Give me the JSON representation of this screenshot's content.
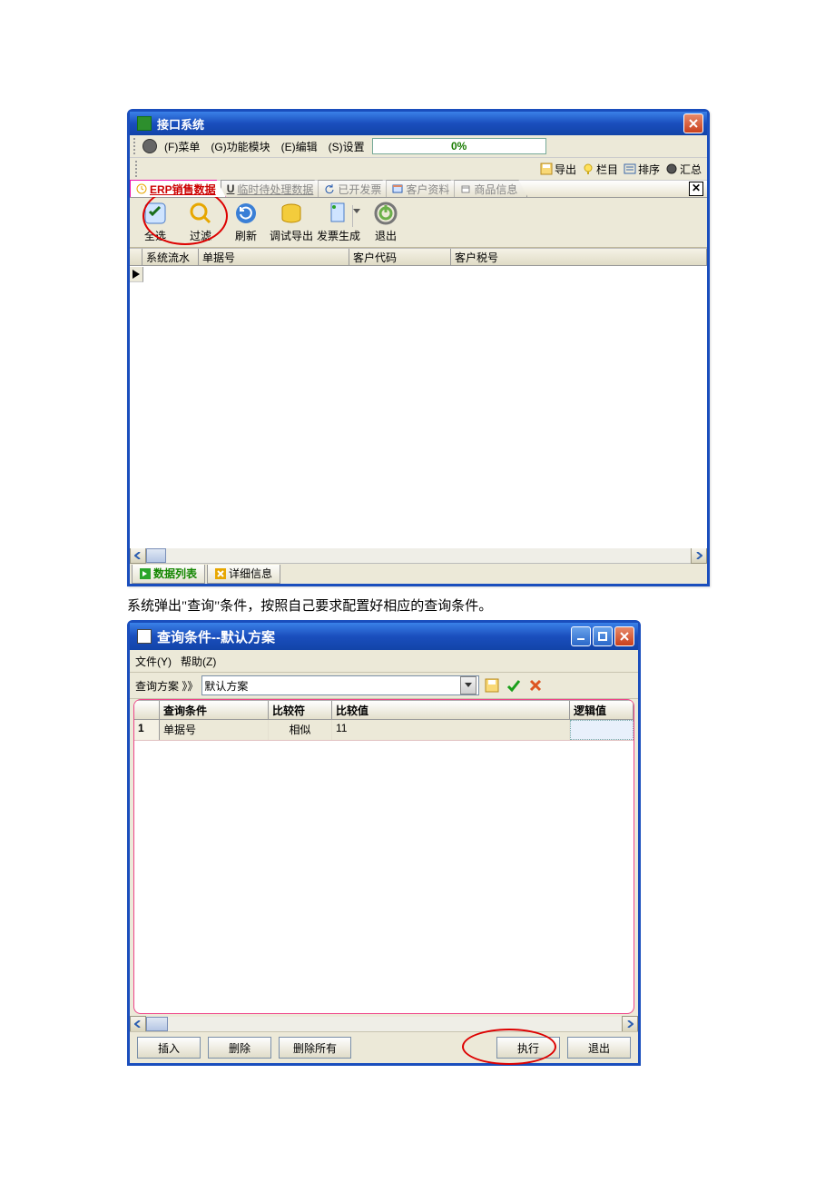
{
  "win1": {
    "title": "接口系统",
    "menubar": {
      "menu": "(F)菜单",
      "module": "(G)功能模块",
      "edit": "(E)编辑",
      "settings": "(S)设置",
      "progress": "0%"
    },
    "righttools": {
      "export": "导出",
      "column": "栏目",
      "sort": "排序",
      "summary": "汇总"
    },
    "tabs": {
      "t0": "ERP销售数据",
      "t1": "临时待处理数据",
      "t2": "已开发票",
      "t3": "客户资料",
      "t4": "商品信息",
      "prefix_u": "U"
    },
    "bigbar": {
      "b0": "全选",
      "b1": "过滤",
      "b2": "刷新",
      "b3": "调试导出",
      "b4": "发票生成",
      "b5": "退出"
    },
    "grid": {
      "c0": "系统流水号",
      "c1": "单据号",
      "c2": "客户代码",
      "c3": "客户税号"
    },
    "bottomtabs": {
      "t0": "数据列表",
      "t1": "详细信息"
    }
  },
  "between_caption": "系统弹出\"查询\"条件，按照自己要求配置好相应的查询条件。",
  "win2": {
    "title": "查询条件--默认方案",
    "menu": {
      "file": "文件(Y)",
      "help": "帮助(Z)"
    },
    "scheme": {
      "label": "查询方案 》》",
      "value": "默认方案"
    },
    "headers": {
      "h0": "查询条件",
      "h1": "比较符",
      "h2": "比较值",
      "h3": "逻辑值"
    },
    "row1": {
      "n": "1",
      "cond": "单据号",
      "op": "相似",
      "val": "11",
      "logic": ""
    },
    "buttons": {
      "insert": "插入",
      "delete": "删除",
      "delall": "删除所有",
      "run": "执行",
      "exit": "退出"
    }
  }
}
